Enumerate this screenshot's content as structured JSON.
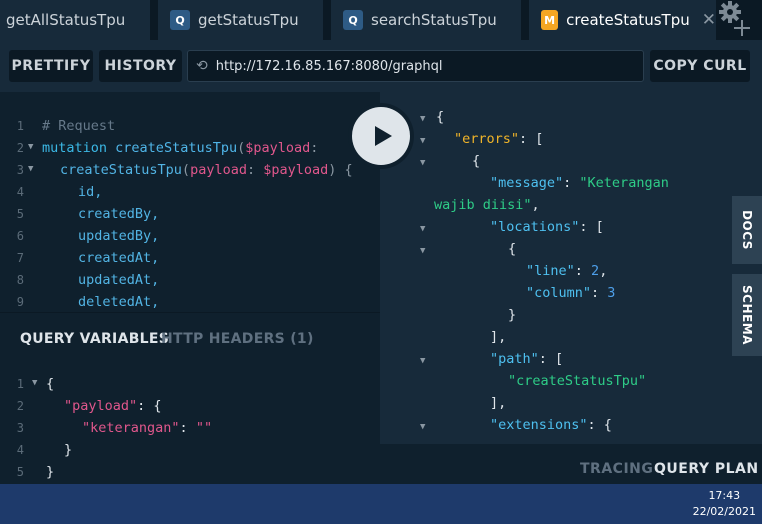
{
  "tabs": [
    {
      "label": "getAllStatusTpu",
      "badge": ""
    },
    {
      "label": "getStatusTpu",
      "badge": "Q"
    },
    {
      "label": "searchStatusTpu",
      "badge": "Q"
    },
    {
      "label": "createStatusTpu",
      "badge": "M",
      "active": true
    }
  ],
  "toolbar": {
    "prettify": "PRETTIFY",
    "history": "HISTORY",
    "url": "http://172.16.85.167:8080/graphql",
    "copy_curl": "COPY CURL"
  },
  "query": {
    "line_numbers": [
      "1",
      "2",
      "3",
      "4",
      "5",
      "6",
      "7",
      "8",
      "9"
    ],
    "comment": "# Request",
    "kw_mutation": "mutation",
    "op_name": "createStatusTpu",
    "var_payload": "$payload",
    "field_create": "createStatusTpu",
    "arg_payload": "payload",
    "fields": [
      "id,",
      "createdBy,",
      "updatedBy,",
      "createdAt,",
      "updatedAt,",
      "deletedAt,"
    ]
  },
  "variables_panel": {
    "tab_variables": "QUERY VARIABLES",
    "tab_headers": "HTTP HEADERS (1)",
    "line_numbers": [
      "1",
      "2",
      "3",
      "4",
      "5"
    ],
    "key_payload": "\"payload\"",
    "key_keterangan": "\"keterangan\"",
    "value_keterangan": "\"\""
  },
  "response": {
    "key_errors": "\"errors\"",
    "key_message": "\"message\"",
    "message_value_1": "\"Keterangan",
    "message_value_2": "wajib diisi\"",
    "key_locations": "\"locations\"",
    "key_line": "\"line\"",
    "line_value": "2",
    "key_column": "\"column\"",
    "column_value": "3",
    "key_path": "\"path\"",
    "path_value": "\"createStatusTpu\"",
    "key_extensions": "\"extensions\""
  },
  "side_tabs": {
    "docs": "DOCS",
    "schema": "SCHEMA"
  },
  "footer": {
    "tracing": "TRACING",
    "query_plan": "QUERY PLAN"
  },
  "taskbar": {
    "time": "17:43",
    "date": "22/02/2021"
  },
  "colors": {
    "accent_mutation": "#f5a623",
    "query_badge": "#2e5b85",
    "string": "#2ecc87",
    "key": "#4ec0f0",
    "variable": "#e0578c"
  }
}
